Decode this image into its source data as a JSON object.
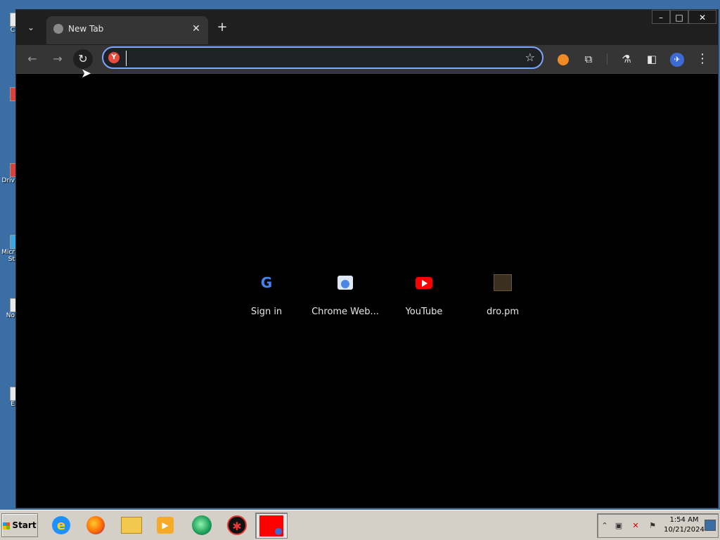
{
  "desktop": {
    "icons": [
      {
        "label": "C",
        "icon": "desktop-app-icon"
      },
      {
        "label": "",
        "icon": "desktop-app-icon"
      },
      {
        "label": "Driv",
        "icon": "desktop-app-icon"
      },
      {
        "label": "Micr St",
        "icon": "desktop-app-icon"
      },
      {
        "label": "No",
        "icon": "desktop-app-icon"
      },
      {
        "label": "E",
        "icon": "desktop-app-icon"
      }
    ]
  },
  "browser": {
    "tab": {
      "title": "New Tab",
      "favicon": "globe-icon"
    },
    "window_controls": {
      "minimize": "–",
      "maximize": "□",
      "close": "✕"
    },
    "toolbar": {
      "back": "←",
      "forward": "→",
      "reload": "↻",
      "omnibox_value": "",
      "site_icon_letter": "Y",
      "bookmark_star": "☆",
      "menu": "⋮"
    },
    "shortcuts": [
      {
        "label": "Sign in",
        "icon": "google-icon",
        "glyph": "G"
      },
      {
        "label": "Chrome Web...",
        "icon": "chrome-web-store-icon"
      },
      {
        "label": "YouTube",
        "icon": "youtube-icon"
      },
      {
        "label": "dro.pm",
        "icon": "dro-pm-icon"
      }
    ]
  },
  "taskbar": {
    "start_label": "Start",
    "apps": [
      {
        "name": "internet-explorer",
        "glyph": "e"
      },
      {
        "name": "firefox",
        "glyph": ""
      },
      {
        "name": "file-explorer",
        "glyph": ""
      },
      {
        "name": "media-player",
        "glyph": "▶"
      },
      {
        "name": "green-app",
        "glyph": ""
      },
      {
        "name": "red-app",
        "glyph": "✱"
      }
    ],
    "clock": {
      "time": "1:54 AM",
      "date": "10/21/2024"
    },
    "tray_expand": "⌃"
  },
  "colors": {
    "accent": "#7ca7ff",
    "titlebar": "#1f1f1f",
    "toolbar": "#353535",
    "desktop": "#3a6ea5"
  }
}
